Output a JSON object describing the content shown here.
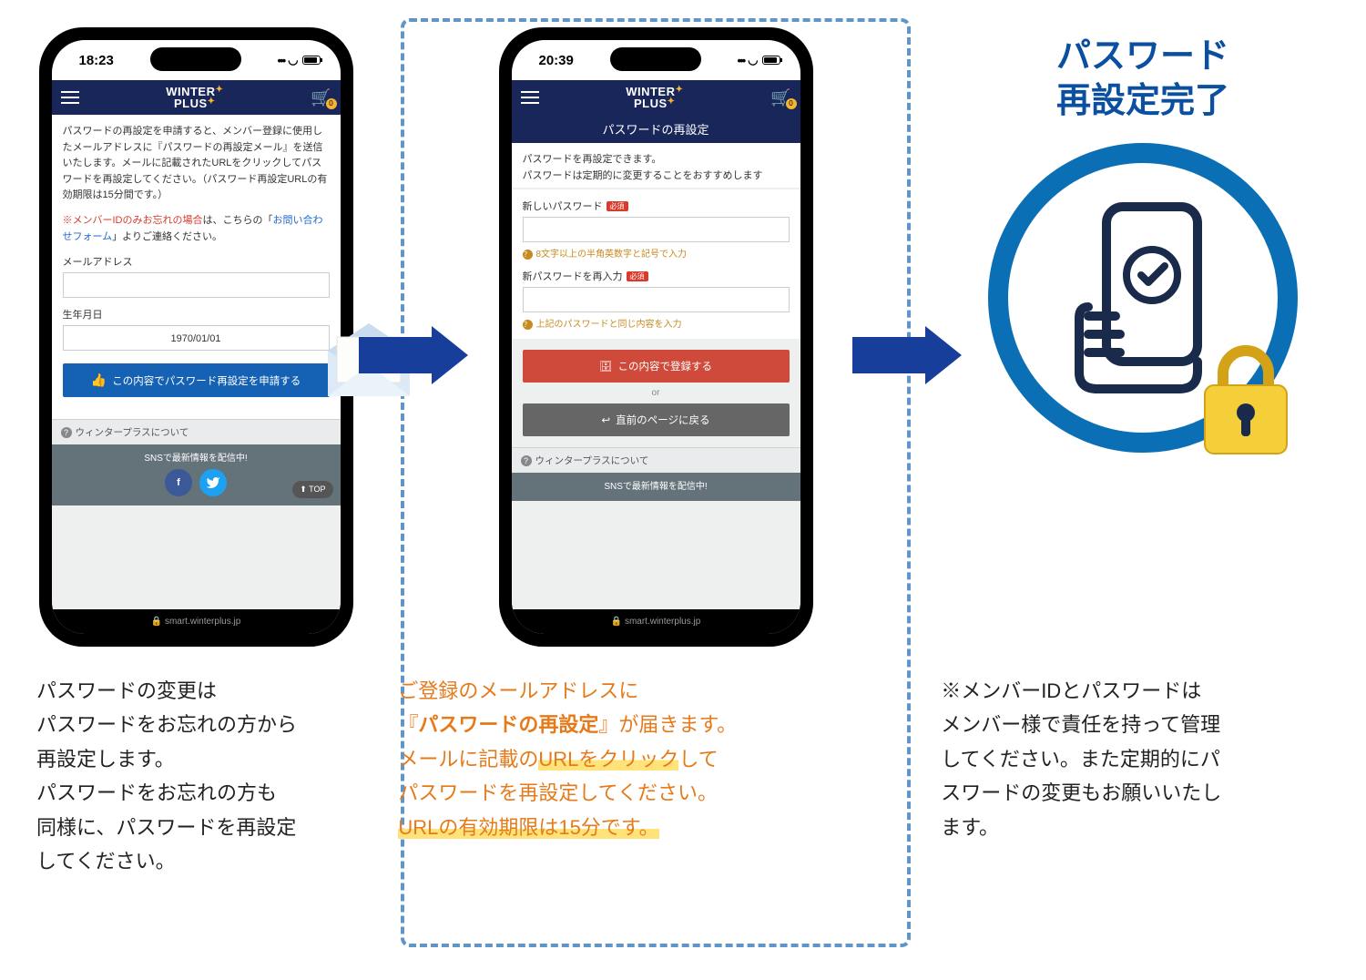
{
  "phone1": {
    "time": "18:23",
    "brand_l1": "WINTER",
    "brand_l2": "PLUS",
    "cart_badge": "0",
    "intro": "パスワードの再設定を申請すると、メンバー登録に使用したメールアドレスに『パスワードの再設定メール』を送信いたします。メールに記載されたURLをクリックしてパスワードを再設定してください。（パスワード再設定URLの有効期限は15分間です。）",
    "warn_prefix": "※メンバーIDのみお忘れの場合",
    "warn_mid": "は、こちらの「",
    "warn_link": "お問い合わせフォーム",
    "warn_suffix": "」よりご連絡ください。",
    "label_email": "メールアドレス",
    "label_dob": "生年月日",
    "dob_value": "1970/01/01",
    "submit": "この内容でパスワード再設定を申請する",
    "footer_about": "ウィンタープラスについて",
    "sns_text": "SNSで最新情報を配信中!",
    "topbtn": "TOP",
    "url": "smart.winterplus.jp"
  },
  "phone2": {
    "time": "20:39",
    "subheader": "パスワードの再設定",
    "p1": "パスワードを再設定できます。",
    "p2": "パスワードは定期的に変更することをおすすめします",
    "label_newpw": "新しいパスワード",
    "required": "必須",
    "hint1": "8文字以上の半角英数字と記号で入力",
    "label_newpw2": "新パスワードを再入力",
    "hint2": "上記のパスワードと同じ内容を入力",
    "btn_submit": "この内容で登録する",
    "or": "or",
    "btn_back": "直前のページに戻る",
    "footer_about": "ウィンタープラスについて",
    "sns_text": "SNSで最新情報を配信中!",
    "url": "smart.winterplus.jp"
  },
  "done": {
    "title_l1": "パスワード",
    "title_l2": "再設定完了"
  },
  "cap1": "パスワードの変更は\nパスワードをお忘れの方から\n再設定します。\nパスワードをお忘れの方も\n同様に、パスワードを再設定\nしてください。",
  "cap2": {
    "l1": "ご登録のメールアドレスに",
    "l2a": "『",
    "l2b": "パスワードの再設定",
    "l2c": "』が届きます。",
    "l3a": "メールに記載の",
    "l3b": "URLをクリック",
    "l3c": "して",
    "l4": "パスワードを再設定してください。",
    "l5": "URLの有効期限は15分です。"
  },
  "cap3": "※メンバーIDとパスワードは\nメンバー様で責任を持って管理\nしてください。また定期的にパ\nスワードの変更もお願いいたし\nます。"
}
